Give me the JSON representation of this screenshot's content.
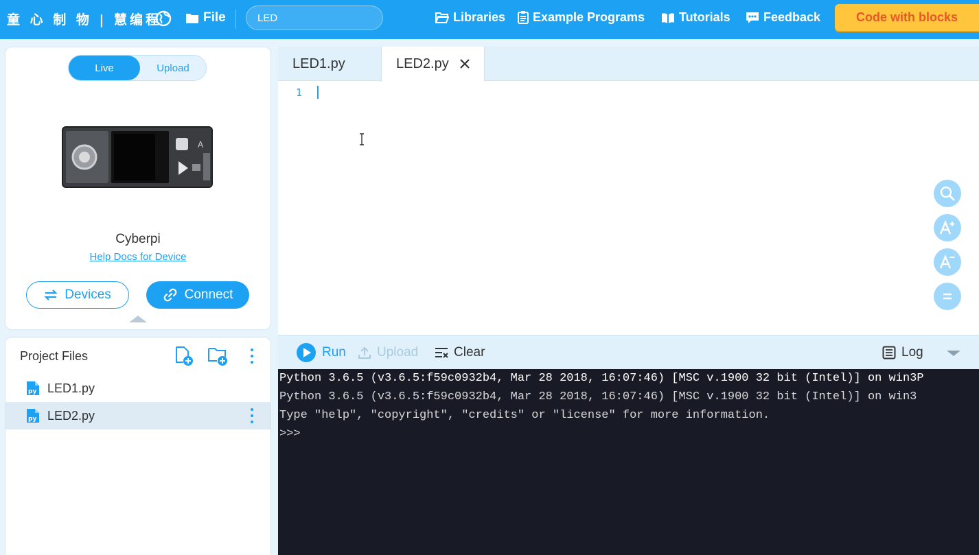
{
  "header": {
    "brand": "童 心 制 物 | 慧编程",
    "file_label": "File",
    "project_name": "LED",
    "nav": {
      "libraries": "Libraries",
      "examples": "Example Programs",
      "tutorials": "Tutorials",
      "feedback": "Feedback"
    },
    "cta_label": "Code with blocks"
  },
  "device": {
    "modes": {
      "live": "Live",
      "upload": "Upload",
      "selected": "Live"
    },
    "name": "Cyberpi",
    "help_link": "Help Docs for Device",
    "devices_button": "Devices",
    "connect_button": "Connect"
  },
  "files": {
    "title": "Project Files",
    "items": [
      {
        "name": "LED1.py",
        "active": false
      },
      {
        "name": "LED2.py",
        "active": true
      }
    ]
  },
  "editor": {
    "tabs": [
      {
        "label": "LED1.py",
        "active": false
      },
      {
        "label": "LED2.py",
        "active": true
      }
    ],
    "line_numbers": [
      "1"
    ]
  },
  "console": {
    "run": "Run",
    "upload": "Upload",
    "clear": "Clear",
    "log": "Log",
    "lines": [
      "Python 3.6.5 (v3.6.5:f59c0932b4, Mar 28 2018, 16:07:46) [MSC v.1900 32 bit (Intel)] on win3P",
      "Python 3.6.5 (v3.6.5:f59c0932b4, Mar 28 2018, 16:07:46) [MSC v.1900 32 bit (Intel)] on win3",
      "Type \"help\", \"copyright\", \"credits\" or \"license\" for more information.",
      ">>>"
    ]
  },
  "colors": {
    "primary": "#1da1f2",
    "cta_bg": "#ffc53d",
    "cta_text": "#e5582a",
    "console_bg": "#181b26",
    "panel_bg": "#e8f4fb"
  }
}
